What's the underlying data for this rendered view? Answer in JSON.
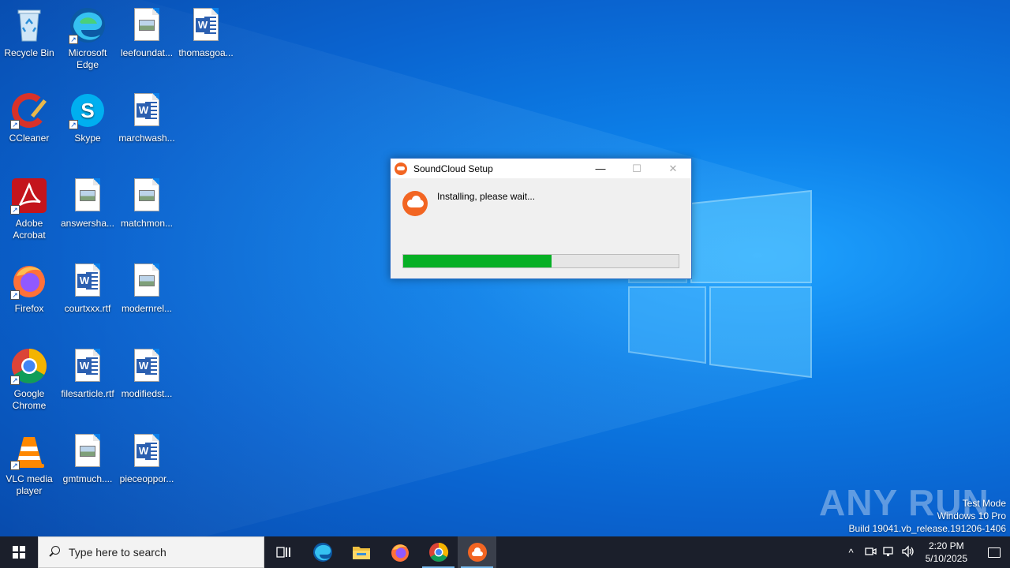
{
  "desktop": {
    "icons": [
      {
        "label": "Recycle Bin",
        "icon": "recycle-bin-icon"
      },
      {
        "label": "Microsoft Edge",
        "icon": "edge-icon"
      },
      {
        "label": "leefoundat...",
        "icon": "image-file-icon"
      },
      {
        "label": "thomasgoa...",
        "icon": "word-document-icon"
      },
      {
        "label": "CCleaner",
        "icon": "ccleaner-icon"
      },
      {
        "label": "Skype",
        "icon": "skype-icon"
      },
      {
        "label": "marchwash...",
        "icon": "word-document-icon"
      },
      {
        "label": "Adobe Acrobat",
        "icon": "acrobat-icon"
      },
      {
        "label": "answersha...",
        "icon": "image-file-icon"
      },
      {
        "label": "matchmon...",
        "icon": "image-file-icon"
      },
      {
        "label": "Firefox",
        "icon": "firefox-icon"
      },
      {
        "label": "courtxxx.rtf",
        "icon": "word-document-icon"
      },
      {
        "label": "modernrel...",
        "icon": "image-file-icon"
      },
      {
        "label": "Google Chrome",
        "icon": "chrome-icon"
      },
      {
        "label": "filesarticle.rtf",
        "icon": "word-document-icon"
      },
      {
        "label": "modifiedst...",
        "icon": "word-document-icon"
      },
      {
        "label": "VLC media player",
        "icon": "vlc-icon"
      },
      {
        "label": "gmtmuch....",
        "icon": "image-file-icon"
      },
      {
        "label": "pieceoppor...",
        "icon": "word-document-icon"
      }
    ]
  },
  "dialog": {
    "title": "SoundCloud Setup",
    "status": "Installing, please wait...",
    "progress": 0.54,
    "minimize": "—",
    "maximize": "☐",
    "close": "✕"
  },
  "watermark": "ANY RUN",
  "system_info": {
    "line1": "Test Mode",
    "line2": "Windows 10 Pro",
    "line3": "Build 19041.vb_release.191206-1406"
  },
  "taskbar": {
    "search_placeholder": "Type here to search",
    "apps": [
      "task-view-icon",
      "edge-icon",
      "file-explorer-icon",
      "firefox-icon",
      "chrome-icon",
      "soundcloud-icon"
    ],
    "tray_chevron": "^",
    "time": "2:20 PM",
    "date": "5/10/2025"
  },
  "colors": {
    "soundcloud_orange": "#f26522",
    "progress_green": "#06b025",
    "taskbar_bg": "#1b1f2b"
  }
}
